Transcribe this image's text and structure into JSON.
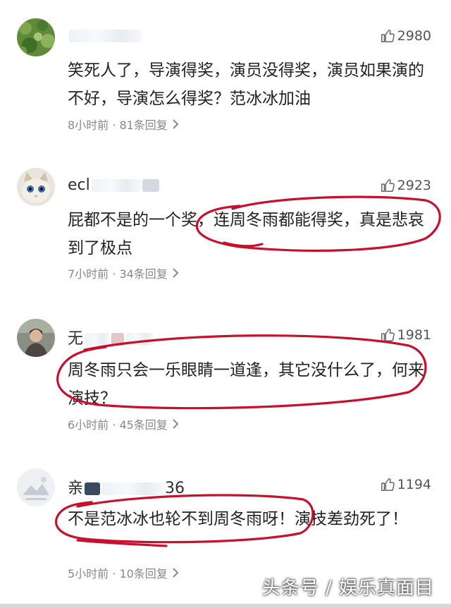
{
  "comments": [
    {
      "username": "",
      "likes": "2980",
      "text": "笑死人了，导演得奖，演员没得奖，演员如果演的不好，导演怎么得奖？范冰冰加油",
      "meta": "8小时前 · 81条回复"
    },
    {
      "username": "ecl",
      "likes": "2923",
      "text": "屁都不是的一个奖，连周冬雨都能得奖，真是悲哀到了极点",
      "meta": "7小时前 · 34条回复"
    },
    {
      "username": "无",
      "likes": "1981",
      "text": "周冬雨只会一乐眼睛一道逢，其它没什么了，何来演技？",
      "meta": "6小时前 · 45条回复"
    },
    {
      "username": "亲",
      "username_tail": "36",
      "likes": "1194",
      "text": "不是范冰冰也轮不到周冬雨呀！演技差劲死了！",
      "meta": "5小时前 · 10条回复"
    }
  ],
  "watermark": "头条号 / 娱乐真面目",
  "colors": {
    "marker": "#c8102e",
    "meta": "#888888",
    "text": "#222222"
  },
  "icons": {
    "like": "thumbs-up-icon",
    "chevron": "chevron-right-icon"
  }
}
